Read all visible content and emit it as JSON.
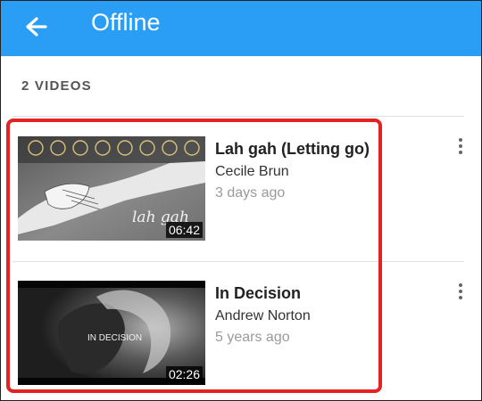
{
  "header": {
    "title": "Offline",
    "back_icon": "arrow-left-icon",
    "background": "#2a9df4"
  },
  "section": {
    "count_label": "2 VIDEOS"
  },
  "videos": [
    {
      "title": "Lah gah (Letting go)",
      "author": "Cecile Brun",
      "age": "3 days ago",
      "duration": "06:42",
      "thumb_caption": "lah gah"
    },
    {
      "title": "In Decision",
      "author": "Andrew Norton",
      "age": "5 years ago",
      "duration": "02:26",
      "thumb_caption": "IN DECISION"
    }
  ],
  "colors": {
    "highlight": "#e32222"
  }
}
